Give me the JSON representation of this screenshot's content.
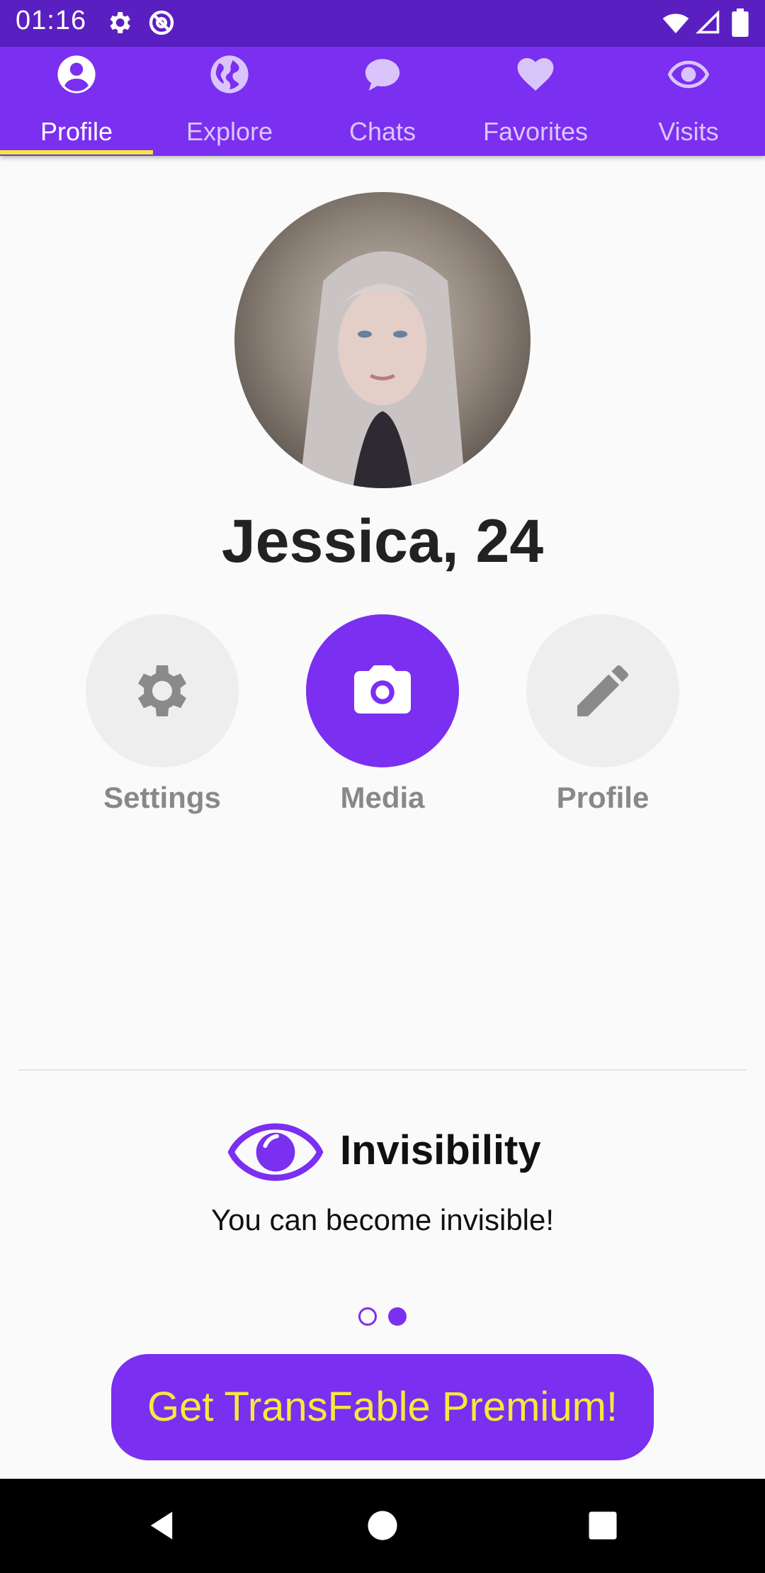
{
  "status_bar": {
    "time": "01:16",
    "icons": [
      "settings-icon",
      "at-sign-icon",
      "wifi-icon",
      "signal-icon",
      "battery-icon"
    ]
  },
  "tabs": [
    {
      "label": "Profile",
      "icon": "user-circle-icon",
      "active": true
    },
    {
      "label": "Explore",
      "icon": "globe-icon",
      "active": false
    },
    {
      "label": "Chats",
      "icon": "chat-bubble-icon",
      "active": false
    },
    {
      "label": "Favorites",
      "icon": "heart-icon",
      "active": false
    },
    {
      "label": "Visits",
      "icon": "eye-icon",
      "active": false
    }
  ],
  "profile": {
    "name_age": "Jessica, 24"
  },
  "actions": [
    {
      "label": "Settings",
      "icon": "gear-icon"
    },
    {
      "label": "Media",
      "icon": "camera-icon"
    },
    {
      "label": "Profile",
      "icon": "pencil-icon"
    }
  ],
  "feature": {
    "title": "Invisibility",
    "description": "You can become invisible!",
    "icon": "eye-icon",
    "page_dots": 2,
    "active_dot": 2
  },
  "premium_button": {
    "label": "Get TransFable Premium!"
  },
  "nav_bar": {
    "icons": [
      "back-icon",
      "home-icon",
      "recents-icon"
    ]
  },
  "colors": {
    "primary": "#7b2ff0",
    "status_bar": "#5a1fc0",
    "accent_yellow": "#f2e83a",
    "background": "#fafafa"
  }
}
